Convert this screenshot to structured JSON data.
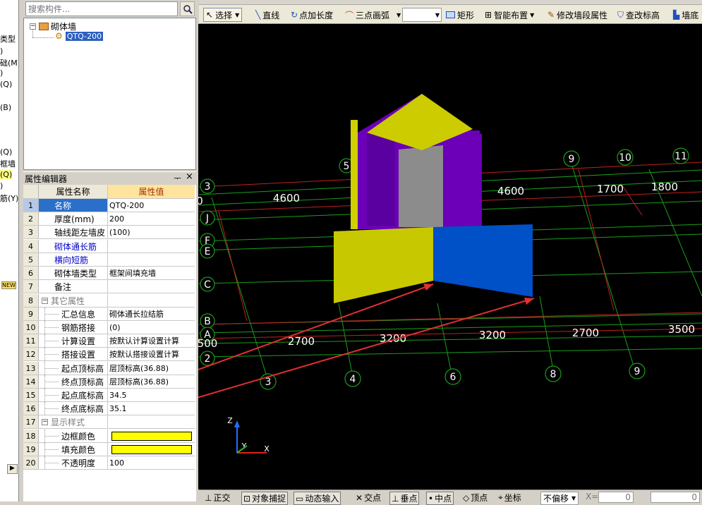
{
  "left_strip": {
    "items": [
      {
        "text": "类型"
      },
      {
        "text": ")"
      },
      {
        "text": "础(M)"
      },
      {
        "text": ")"
      },
      {
        "text": "(Q)"
      },
      {
        "text": "(B)"
      },
      {
        "text": "(Q)"
      },
      {
        "text": "框墙"
      },
      {
        "text": "(Q)"
      },
      {
        "text": ")"
      },
      {
        "text": "筋(Y)"
      },
      {
        "text": "NEW"
      }
    ]
  },
  "search": {
    "placeholder": "搜索构件..."
  },
  "tree": {
    "root": "砌体墙",
    "child": "QTQ-200"
  },
  "props": {
    "title": "属性编辑器",
    "pin": "ᅮ",
    "close": "×",
    "header_name": "属性名称",
    "header_value": "属性值",
    "rows": [
      {
        "n": "1",
        "name": "名称",
        "value": "QTQ-200"
      },
      {
        "n": "2",
        "name": "厚度(mm)",
        "value": "200"
      },
      {
        "n": "3",
        "name": "轴线距左墙皮",
        "value": "(100)"
      },
      {
        "n": "4",
        "name": "砌体通长筋",
        "value": ""
      },
      {
        "n": "5",
        "name": "横向短筋",
        "value": ""
      },
      {
        "n": "6",
        "name": "砌体墙类型",
        "value": "框架间填充墙"
      },
      {
        "n": "7",
        "name": "备注",
        "value": ""
      },
      {
        "n": "8",
        "name": "其它属性",
        "value": ""
      },
      {
        "n": "9",
        "name": "汇总信息",
        "value": "砌体通长拉结筋"
      },
      {
        "n": "10",
        "name": "钢筋搭接",
        "value": "(0)"
      },
      {
        "n": "11",
        "name": "计算设置",
        "value": "按默认计算设置计算"
      },
      {
        "n": "12",
        "name": "搭接设置",
        "value": "按默认搭接设置计算"
      },
      {
        "n": "13",
        "name": "起点顶标高",
        "value": "层顶标高(36.88)"
      },
      {
        "n": "14",
        "name": "终点顶标高",
        "value": "层顶标高(36.88)"
      },
      {
        "n": "15",
        "name": "起点底标高",
        "value": "34.5"
      },
      {
        "n": "16",
        "name": "终点底标高",
        "value": "35.1"
      },
      {
        "n": "17",
        "name": "显示样式",
        "value": ""
      },
      {
        "n": "18",
        "name": "边框颜色",
        "value": ""
      },
      {
        "n": "19",
        "name": "填充颜色",
        "value": ""
      },
      {
        "n": "20",
        "name": "不透明度",
        "value": "100"
      }
    ],
    "swatch_color": "#ffff00"
  },
  "toolbar": {
    "select": "选择",
    "line": "直线",
    "point_length": "点加长度",
    "arc": "三点画弧",
    "rect": "矩形",
    "smart": "智能布置",
    "modify": "修改墙段属性",
    "check_elev": "查改标高",
    "wall_base": "墙底"
  },
  "status": {
    "ortho": "正交",
    "snap": "对象捕捉",
    "dyn": "动态输入",
    "intersect": "交点",
    "perp": "垂点",
    "mid": "中点",
    "vertex": "顶点",
    "coord": "坐标",
    "offset": "不偏移",
    "x_label": "X=",
    "x_val": "0",
    "y_val": "0"
  },
  "viewport": {
    "axis_labels": [
      "3",
      "J",
      "F",
      "E",
      "C",
      "B",
      "A",
      "2",
      "5",
      "9",
      "10",
      "11",
      "3",
      "4",
      "6",
      "8",
      "9"
    ],
    "dims": [
      "4600",
      "4600",
      "1700",
      "1800",
      "2700",
      "3200",
      "3200",
      "2700",
      "3500",
      "500",
      "0"
    ],
    "axes_xyz": [
      "Z",
      "Y",
      "X"
    ]
  }
}
